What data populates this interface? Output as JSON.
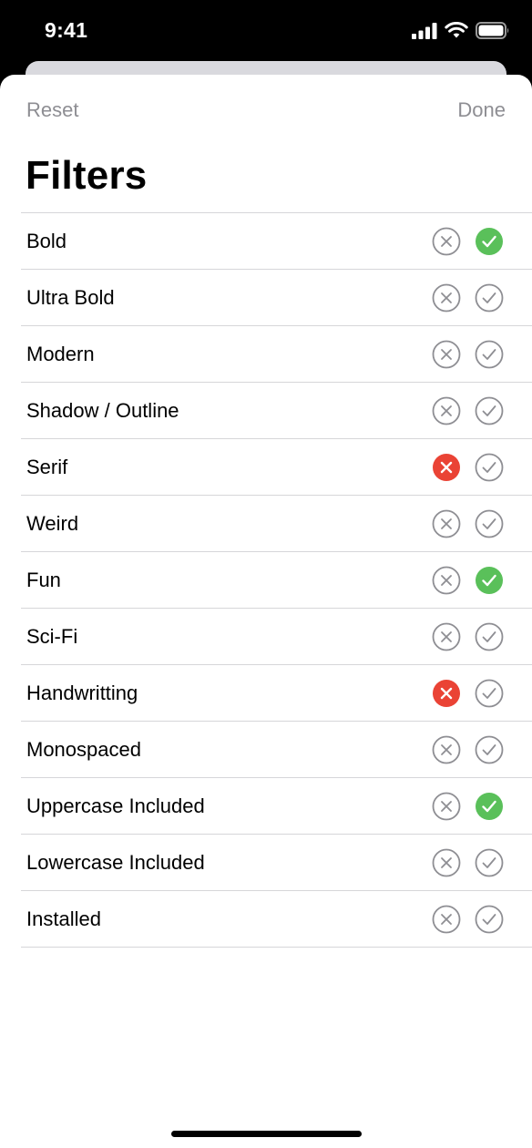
{
  "status_bar": {
    "time": "9:41"
  },
  "header": {
    "reset_label": "Reset",
    "done_label": "Done",
    "title": "Filters"
  },
  "colors": {
    "exclude_active": "#ea4335",
    "include_active": "#5ac05a",
    "inactive_stroke": "#8e8e93",
    "separator": "#d6d6d9"
  },
  "filters": [
    {
      "label": "Bold",
      "state": "include"
    },
    {
      "label": "Ultra Bold",
      "state": "none"
    },
    {
      "label": "Modern",
      "state": "none"
    },
    {
      "label": "Shadow / Outline",
      "state": "none"
    },
    {
      "label": "Serif",
      "state": "exclude"
    },
    {
      "label": "Weird",
      "state": "none"
    },
    {
      "label": "Fun",
      "state": "include"
    },
    {
      "label": "Sci-Fi",
      "state": "none"
    },
    {
      "label": "Handwritting",
      "state": "exclude"
    },
    {
      "label": "Monospaced",
      "state": "none"
    },
    {
      "label": "Uppercase Included",
      "state": "include"
    },
    {
      "label": "Lowercase Included",
      "state": "none"
    },
    {
      "label": "Installed",
      "state": "none"
    }
  ]
}
